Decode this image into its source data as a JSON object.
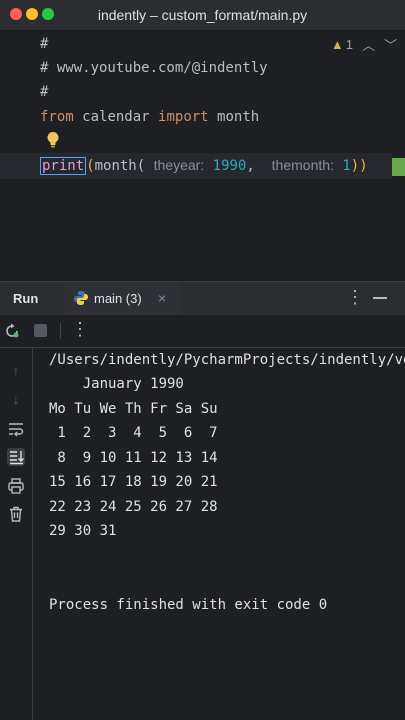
{
  "window": {
    "title": "indently – custom_format/main.py"
  },
  "editor": {
    "lines": [
      {
        "text": "#"
      },
      {
        "text": "# www.youtube.com/@indently"
      },
      {
        "text": "#"
      }
    ],
    "import_line": {
      "kw1": "from",
      "module": "calendar",
      "kw2": "import",
      "name": "month"
    },
    "print_line": {
      "print": "print",
      "open": "(",
      "func": "month(",
      "hint1": "theyear:",
      "val1": "1990",
      "comma": ",",
      "hint2": "themonth:",
      "val2": "1",
      "close": "))"
    },
    "warnings_count": "1"
  },
  "panel": {
    "run_label": "Run",
    "tab_label": "main (3)",
    "tab_close": "×"
  },
  "console": {
    "lines": [
      "/Users/indently/PycharmProjects/indently/venv/bin/python",
      "    January 1990",
      "Mo Tu We Th Fr Sa Su",
      " 1  2  3  4  5  6  7",
      " 8  9 10 11 12 13 14",
      "15 16 17 18 19 20 21",
      "22 23 24 25 26 27 28",
      "29 30 31",
      "",
      "",
      "Process finished with exit code 0"
    ]
  },
  "colors": {
    "accent": "#4a88c7",
    "keyword": "#cf8e6d",
    "number": "#2aacb8",
    "function": "#56a8f5"
  },
  "icons": {
    "window_buttons": [
      "close-dot",
      "minimize-dot",
      "zoom-dot"
    ],
    "toolbar": [
      "rerun-icon",
      "stop-icon",
      "more-vertical-icon"
    ],
    "sidebar": [
      "arrow-up-icon",
      "arrow-down-icon",
      "soft-wrap-icon",
      "scroll-to-end-icon",
      "print-icon",
      "trash-icon"
    ]
  }
}
